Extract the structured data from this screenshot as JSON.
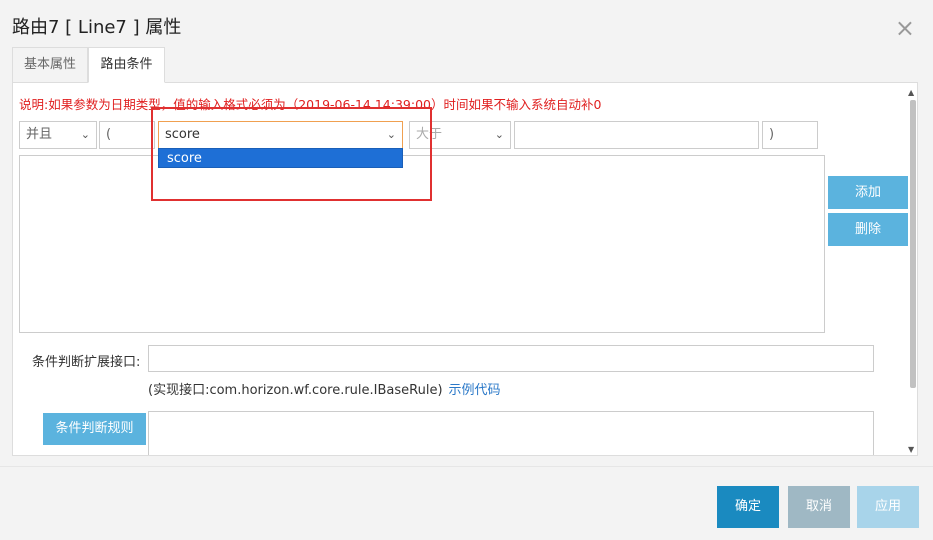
{
  "window": {
    "title": "路由7 [ Line7 ] 属性",
    "close_glyph": "×"
  },
  "tabs": [
    {
      "label": "基本属性"
    },
    {
      "label": "路由条件"
    }
  ],
  "note": "说明:如果参数为日期类型，值的输入格式必须为（2019-06-14 14:39:00）时间如果不输入系统自动补0",
  "condition_row": {
    "logic": "并且",
    "left_paren": "(",
    "field": "score",
    "operator": "大于",
    "value": "",
    "right_paren": ")"
  },
  "dropdown": {
    "options": [
      "score"
    ],
    "selected": "score"
  },
  "side_buttons": {
    "add": "添加",
    "delete": "删除"
  },
  "extension": {
    "label": "条件判断扩展接口:",
    "value": "",
    "impl_text": "(实现接口:com.horizon.wf.core.rule.IBaseRule)",
    "example_link": "示例代码"
  },
  "rule": {
    "button": "条件判断规则",
    "value": ""
  },
  "footer": {
    "ok": "确定",
    "cancel": "取消",
    "apply": "应用"
  },
  "colors": {
    "accent": "#5bb3de",
    "primary": "#1a8ac0",
    "warning_text": "#e02020",
    "highlight_box": "#e03030",
    "dropdown_selected": "#1e6fd6"
  }
}
